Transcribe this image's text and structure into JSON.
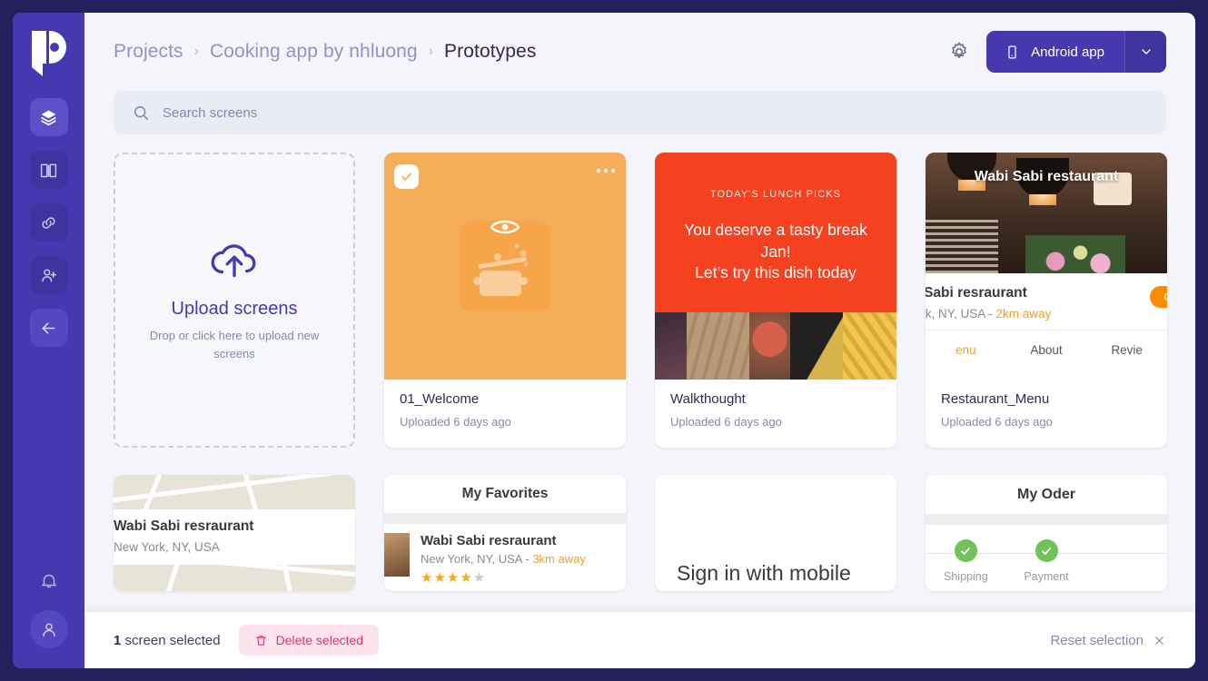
{
  "sidebar": {
    "logo_icon": "pitch-logo-icon",
    "items": [
      {
        "icon": "layers-icon",
        "name": "screens",
        "active": true
      },
      {
        "icon": "book-icon",
        "name": "library",
        "active": false
      },
      {
        "icon": "link-icon",
        "name": "share-link",
        "active": false
      },
      {
        "icon": "add-person-icon",
        "name": "invite",
        "active": false
      },
      {
        "icon": "arrow-left-icon",
        "name": "back",
        "active": false
      }
    ],
    "bottom": [
      {
        "icon": "bell-icon",
        "name": "notifications"
      },
      {
        "icon": "user-icon",
        "name": "account"
      }
    ]
  },
  "header": {
    "breadcrumbs": [
      {
        "label": "Projects",
        "current": false
      },
      {
        "label": "Cooking app by nhluong",
        "current": false
      },
      {
        "label": "Prototypes",
        "current": true
      }
    ],
    "separator": "›",
    "settings_icon": "gear-icon",
    "device_select": {
      "label": "Android app",
      "icon": "phone-icon",
      "caret_icon": "chevron-down-icon"
    }
  },
  "search": {
    "placeholder": "Search screens",
    "value": "",
    "icon": "search-icon"
  },
  "upload": {
    "icon": "cloud-upload-icon",
    "title": "Upload screens",
    "subtitle": "Drop or click here to upload new screens"
  },
  "screens": [
    {
      "name": "01_Welcome",
      "uploaded": "Uploaded 6 days ago",
      "selected": true,
      "menu_icon": "more-options-icon",
      "check_icon": "check-icon",
      "preview_icon": "eye-icon",
      "thumb_color": "#f6ad5a"
    },
    {
      "name": "Walkthought",
      "uploaded": "Uploaded 6 days ago",
      "selected": false,
      "thumb_color": "#f4411f",
      "preview": {
        "kicker": "TODAY'S LUNCH PICKS",
        "headline_line1": "You deserve a tasty break Jan!",
        "headline_line2": "Let’s try this dish today"
      }
    },
    {
      "name": "Restaurant_Menu",
      "uploaded": "Uploaded 6 days ago",
      "selected": false,
      "preview": {
        "photo_title": "Wabi Sabi restaurant",
        "restaurant": "bi Sabi resraurant",
        "address": "York, NY, USA - ",
        "distance": "2km away",
        "badge": "O",
        "tabs": [
          "enu",
          "About",
          "Revie"
        ]
      }
    }
  ],
  "row2": {
    "map_card": {
      "restaurant": "Wabi Sabi resraurant",
      "address": "New York, NY, USA"
    },
    "favorites_card": {
      "title": "My Favorites",
      "item_name": "Wabi Sabi resraurant",
      "item_address": "New York, NY, USA - ",
      "item_distance": "3km away",
      "rating_filled": "★★★★",
      "rating_empty": "★"
    },
    "signin_card": {
      "title": "Sign in with mobile"
    },
    "order_card": {
      "title": "My Oder",
      "steps": [
        {
          "label": "Shipping",
          "done": true,
          "icon": "check-circle-icon"
        },
        {
          "label": "Payment",
          "done": true,
          "icon": "check-circle-icon"
        }
      ]
    }
  },
  "selection_bar": {
    "count": "1",
    "count_label": " screen selected",
    "delete_label": "Delete selected",
    "delete_icon": "trash-icon",
    "reset_label": "Reset selection",
    "close_icon": "close-icon"
  },
  "colors": {
    "brand_purple": "#4639b0",
    "frame_navy": "#261f5e",
    "accent_orange": "#f6ad5a",
    "accent_red": "#f4411f",
    "danger_pink": "#e0356b",
    "success_green": "#71c257",
    "page_bg": "#f4f5fa"
  }
}
